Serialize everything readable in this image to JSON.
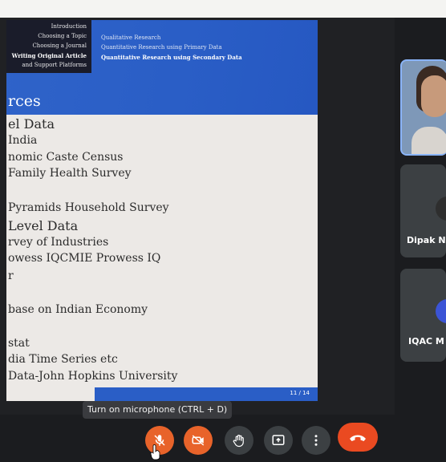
{
  "slide": {
    "nav_left": [
      "Introduction",
      "Choosing a Topic",
      "Choosing a Journal",
      "Writing Original Article",
      "and Support Platforms"
    ],
    "nav_right": [
      "Qualitative Research",
      "Quantitative Research using Primary Data",
      "Quantitative Research using Secondary Data"
    ],
    "title": "rces",
    "bullets": [
      {
        "text": "el Data",
        "level": 1
      },
      {
        "text": "India",
        "level": 2
      },
      {
        "text": "nomic Caste Census",
        "level": 2
      },
      {
        "text": "Family Health Survey",
        "level": 2
      },
      {
        "text": "Pyramids Household Survey",
        "level": 2
      },
      {
        "text": "Level Data",
        "level": 1
      },
      {
        "text": "rvey of Industries",
        "level": 2
      },
      {
        "text": "owess IQCMIE Prowess IQ",
        "level": 2
      },
      {
        "text": "r",
        "level": 2
      },
      {
        "text": "base on Indian Economy",
        "level": 2
      },
      {
        "text": "stat",
        "level": 2
      },
      {
        "text": "dia Time Series etc",
        "level": 2
      },
      {
        "text": "Data-John Hopkins University",
        "level": 2
      }
    ],
    "page": "11 / 14"
  },
  "participants": [
    {
      "name": "Dipak N"
    },
    {
      "name": "IQAC M"
    }
  ],
  "tooltip": "Turn on microphone (CTRL + D)",
  "controls": {
    "mic": {
      "state": "off",
      "icon": "mic-off-icon"
    },
    "camera": {
      "state": "off",
      "icon": "camera-off-icon"
    },
    "raise_hand": {
      "icon": "hand-icon"
    },
    "present": {
      "icon": "present-screen-icon"
    },
    "more": {
      "icon": "more-vert-icon"
    },
    "end_call": {
      "icon": "end-call-icon"
    }
  },
  "colors": {
    "slide_blue": "#2a5ec6",
    "control_red": "#e8632a",
    "end_call_red": "#ea4a21",
    "control_grey": "#3c4043"
  }
}
